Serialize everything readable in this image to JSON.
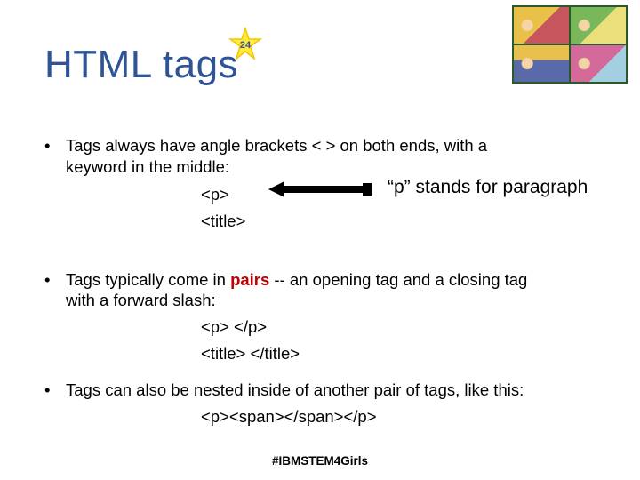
{
  "title": "HTML tags",
  "star_badge": "24",
  "bullets": {
    "b1": {
      "text_a": "Tags always have angle brackets < > on both ends, with a",
      "text_b": "keyword in the middle:",
      "ex1": "<p>",
      "ex2": "<title>"
    },
    "b2": {
      "text_a": "Tags typically come in ",
      "pairs": "pairs",
      "text_b": " -- an opening tag and a closing tag",
      "text_c": "with a forward slash:",
      "ex1": "<p> </p>",
      "ex2": "<title> </title>"
    },
    "b3": {
      "text": "Tags can also be nested inside of another pair of tags, like this:",
      "ex1": "<p><span></span></p>"
    }
  },
  "callout": "“p” stands for paragraph",
  "footer": "#IBMSTEM4Girls",
  "icons": {
    "star": "star-icon",
    "arrow": "left-arrow-icon",
    "art": "cartoon-grid"
  }
}
